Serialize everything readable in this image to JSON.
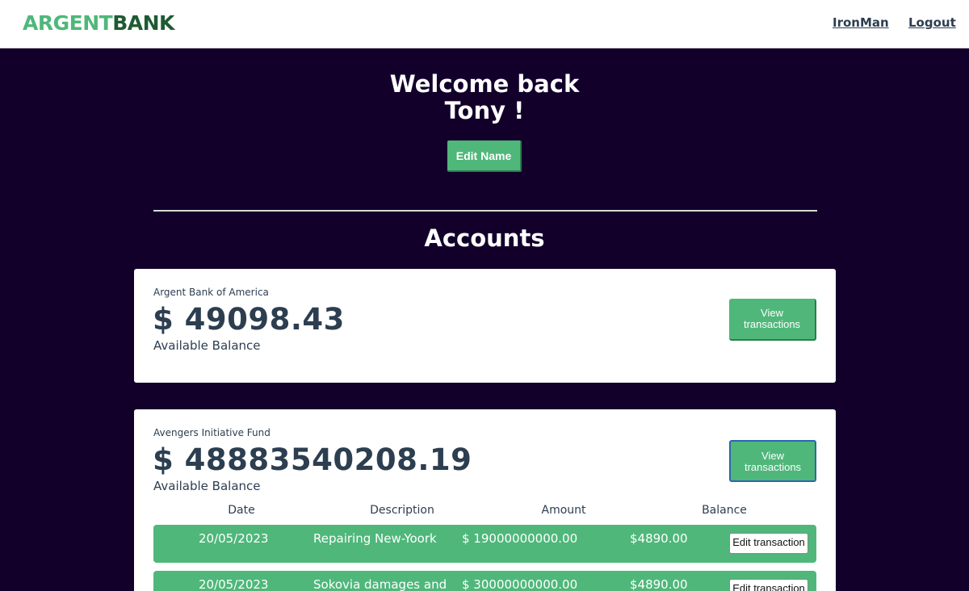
{
  "header": {
    "logo_part1": "ARGENT",
    "logo_part2": "BANK",
    "user_link": "IronMan",
    "logout_link": "Logout"
  },
  "welcome": {
    "line1": "Welcome back",
    "line2": "Tony !",
    "edit_name_label": "Edit Name"
  },
  "accounts_title": "Accounts",
  "accounts": [
    {
      "name": "Argent Bank of America",
      "amount": "$ 49098.43",
      "description": "Available Balance",
      "button_line1": "View",
      "button_line2": "transactions"
    },
    {
      "name": "Avengers Initiative Fund",
      "amount": "$ 48883540208.19",
      "description": "Available Balance",
      "button_line1": "View",
      "button_line2": "transactions",
      "transactions_header": {
        "date": "Date",
        "description": "Description",
        "amount": "Amount",
        "balance": "Balance"
      },
      "transactions": [
        {
          "date": "20/05/2023",
          "description": "Repairing New-Yoork",
          "amount": "$ 19000000000.00",
          "balance": "$4890.00",
          "edit_label": "Edit transaction"
        },
        {
          "date": "20/05/2023",
          "description": "Sokovia damages and",
          "amount": "$ 30000000000.00",
          "balance": "$4890.00",
          "edit_label": "Edit transaction"
        }
      ]
    }
  ],
  "colors": {
    "brand_green": "#4fb77a",
    "brand_dark_green": "#1f5a33",
    "background_dark": "#12002b",
    "text_dark": "#2c3e50",
    "focus_blue": "#2f65b0"
  }
}
